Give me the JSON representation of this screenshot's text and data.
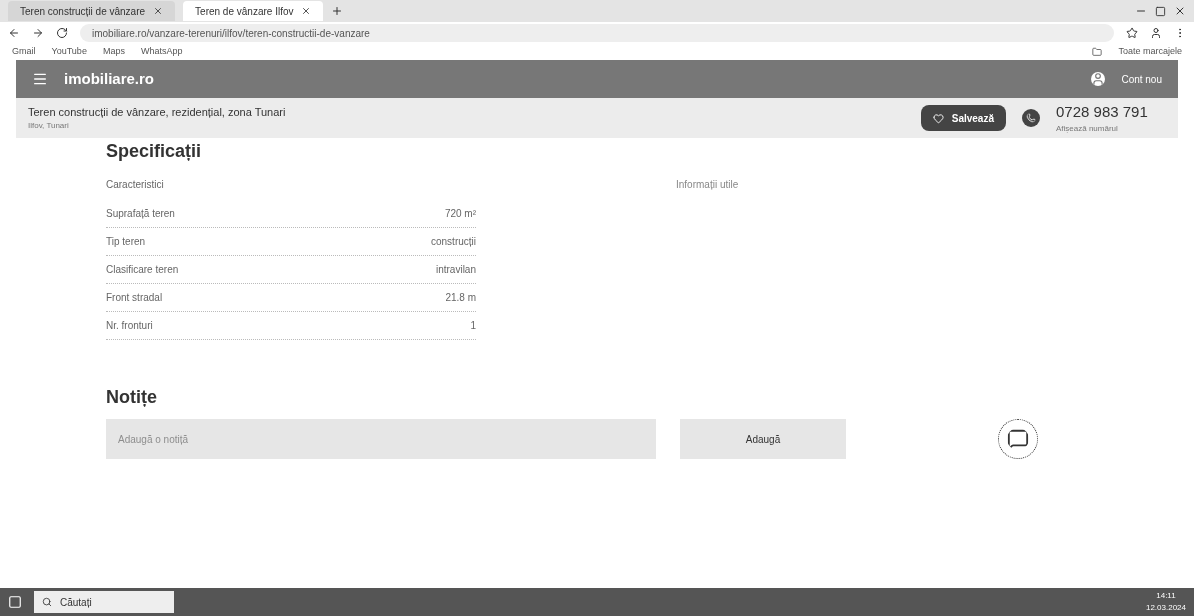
{
  "browser": {
    "tabs": [
      {
        "label": "Teren construcții de vânzare",
        "selected": false
      },
      {
        "label": "Teren de vânzare Ilfov",
        "selected": true
      }
    ],
    "url": "imobiliare.ro/vanzare-terenuri/ilfov/teren-constructii-de-vanzare",
    "bookmarks": [
      "Gmail",
      "YouTube",
      "Maps",
      "WhatsApp"
    ],
    "all_bookmarks": "Toate marcajele"
  },
  "site": {
    "logo": "imobiliare.ro",
    "user": "Cont nou"
  },
  "listing": {
    "title": "Teren construcții de vânzare, rezidențial, zona Tunari",
    "subtitle": "Ilfov, Tunari",
    "save": "Salvează",
    "phone": "0728 983 791",
    "phone_note": "Afișează numărul"
  },
  "specs": {
    "heading": "Specificații",
    "group": "Caracteristici",
    "side_note": "Informații utile",
    "rows": [
      {
        "label": "Suprafață teren",
        "value": "720 m²"
      },
      {
        "label": "Tip teren",
        "value": "construcții"
      },
      {
        "label": "Clasificare teren",
        "value": "intravilan"
      },
      {
        "label": "Front stradal",
        "value": "21.8 m"
      },
      {
        "label": "Nr. fronturi",
        "value": "1"
      }
    ]
  },
  "notes": {
    "heading": "Notițe",
    "placeholder": "Adaugă o notiță",
    "button": "Adaugă"
  },
  "taskbar": {
    "search": "Căutați",
    "time": "14:11",
    "date": "12.03.2024"
  }
}
